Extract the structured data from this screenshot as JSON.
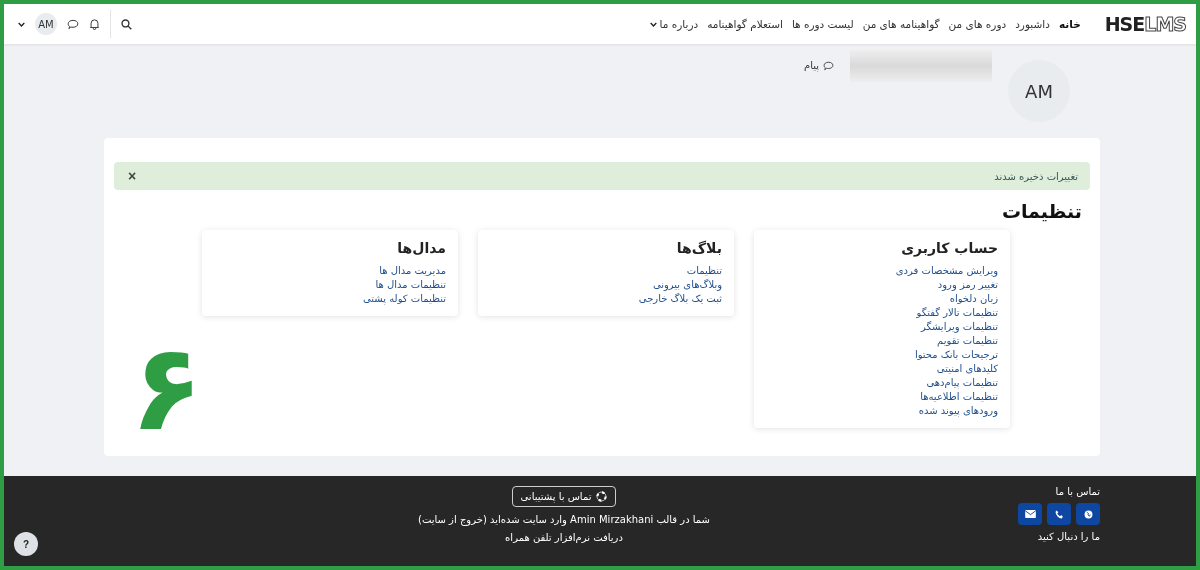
{
  "logo": {
    "bold": "HSE",
    "outline": "LMS"
  },
  "nav": [
    {
      "label": "خانه",
      "selected": true,
      "dropdown": false
    },
    {
      "label": "داشبورد",
      "selected": false,
      "dropdown": false
    },
    {
      "label": "دوره های من",
      "selected": false,
      "dropdown": false
    },
    {
      "label": "گواهینامه های من",
      "selected": false,
      "dropdown": false
    },
    {
      "label": "لیست دوره ها",
      "selected": false,
      "dropdown": false
    },
    {
      "label": "استعلام گواهینامه",
      "selected": false,
      "dropdown": false
    },
    {
      "label": "درباره ما",
      "selected": false,
      "dropdown": true
    }
  ],
  "user_menu": {
    "initials": "AM"
  },
  "profile": {
    "initials": "AM",
    "message_link": "پیام"
  },
  "alert": {
    "text": "تغییرات ذخیره شدند",
    "close": "×"
  },
  "page_title": "تنظیمات",
  "sections": [
    {
      "title": "حساب کاربری",
      "links": [
        "ویرایش مشخصات فردی",
        "تغییر رمز ورود",
        "زبان دلخواه",
        "تنظیمات تالار گفتگو",
        "تنظیمات ویرایشگر",
        "تنظیمات تقویم",
        "ترجیحات بانک محتوا",
        "کلیدهای امنیتی",
        "تنظیمات پیام‌دهی",
        "تنظیمات اطلاعیه‌ها",
        "ورودهای پیوند شده"
      ]
    },
    {
      "title": "بلاگ‌ها",
      "links": [
        "تنظیمات",
        "وبلاگ‌های بیرونی",
        "ثبت یک بلاگ خارجی"
      ]
    },
    {
      "title": "مدال‌ها",
      "links": [
        "مدیریت مدال ها",
        "تنظیمات مدال ها",
        "تنظیمات کوله پشتی"
      ]
    }
  ],
  "annotation": "۶",
  "footer": {
    "contact_title": "تماس با ما",
    "contact_buttons": [
      {
        "kind": "web"
      },
      {
        "kind": "phone"
      },
      {
        "kind": "email"
      }
    ],
    "follow_title": "ما را دنبال کنید",
    "support_button": "تماس با پشتیبانی",
    "login": {
      "before": "شما در قالب ",
      "user": "Amin Mirzakhani",
      "middle": " وارد سایت شده‌اید ",
      "logout": "(خروج از سایت)"
    },
    "app_link": "دریافت نرم‌افزار تلفن همراه",
    "help": "?"
  }
}
